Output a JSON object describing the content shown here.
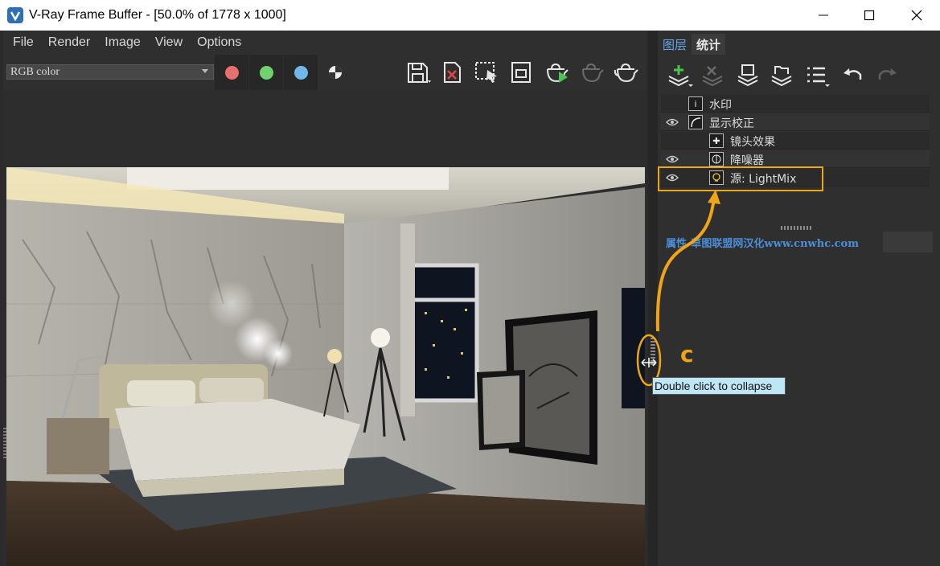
{
  "window": {
    "title": "V-Ray Frame Buffer - [50.0% of 1778 x 1000]"
  },
  "menu": [
    "File",
    "Render",
    "Image",
    "View",
    "Options"
  ],
  "toolbar": {
    "channel_select": "RGB color",
    "channel_colors": {
      "red": "#e86f6f",
      "green": "#6fd26f",
      "blue": "#6fb8ea"
    },
    "icons": [
      "save-icon",
      "clear-image-icon",
      "track-region-icon",
      "region-render-icon",
      "render-icon",
      "stop-render-icon",
      "teapot-icon"
    ]
  },
  "right_panel": {
    "tabs": [
      "图层",
      "统计"
    ],
    "icons": [
      "add-layer-icon",
      "delete-layer-icon",
      "save-layers-icon",
      "load-layers-icon",
      "layer-menu-icon",
      "undo-icon",
      "redo-icon"
    ],
    "layers": [
      {
        "label": "水印",
        "icon": "i",
        "visible": false,
        "indent": 0
      },
      {
        "label": "显示校正",
        "icon": "curve",
        "visible": true,
        "indent": 0
      },
      {
        "label": "镜头效果",
        "icon": "+",
        "visible": false,
        "indent": 1
      },
      {
        "label": "降噪器",
        "icon": "denoiser",
        "visible": true,
        "indent": 1
      },
      {
        "label": "源: LightMix",
        "icon": "bulb",
        "visible": true,
        "indent": 1
      }
    ],
    "properties_label": "属性-草图联盟网汉化www.cnwhc.com"
  },
  "annotation": {
    "tooltip": "Double click to collapse",
    "label": "c",
    "color": "#f0a418"
  }
}
